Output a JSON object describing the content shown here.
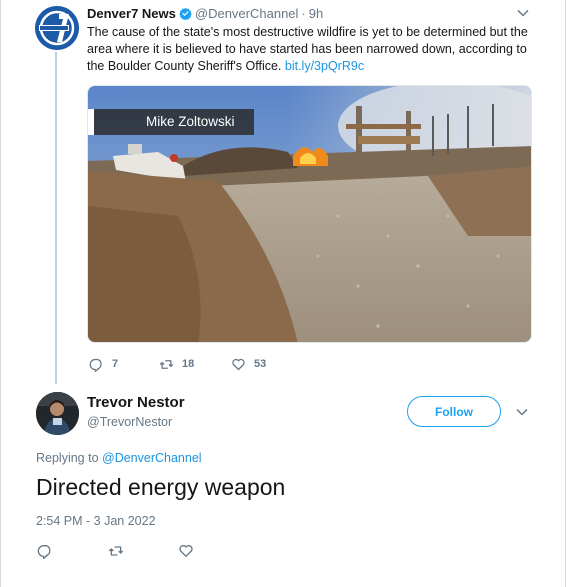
{
  "parent_tweet": {
    "display_name": "Denver7 News",
    "handle": "@DenverChannel",
    "separator": "·",
    "time": "9h",
    "text": "The cause of the state's most destructive wildfire is yet to be determined but the area where it is believed to have started has been narrowed down, according to the Boulder County Sheriff's Office. ",
    "link_text": "bit.ly/3pQrR9c",
    "media_caption": "Mike Zoltowski",
    "reply_count": "7",
    "retweet_count": "18",
    "like_count": "53",
    "icons": {
      "verified": "verified-badge-icon",
      "menu": "chevron-down-icon",
      "reply": "reply-icon",
      "retweet": "retweet-icon",
      "like": "heart-icon"
    }
  },
  "main_tweet": {
    "display_name": "Trevor Nestor",
    "handle": "@TrevorNestor",
    "follow_label": "Follow",
    "replying_prefix": "Replying to ",
    "replying_handle": "@DenverChannel",
    "text": "Directed energy weapon",
    "timestamp": "2:54 PM - 3 Jan 2022",
    "icons": {
      "menu": "chevron-down-icon",
      "reply": "reply-icon",
      "retweet": "retweet-icon",
      "like": "heart-icon"
    }
  },
  "colors": {
    "accent": "#1da1f2",
    "link": "#1b95e0",
    "muted": "#657786",
    "thread_line": "#b4d3ee",
    "text": "#14171a"
  }
}
